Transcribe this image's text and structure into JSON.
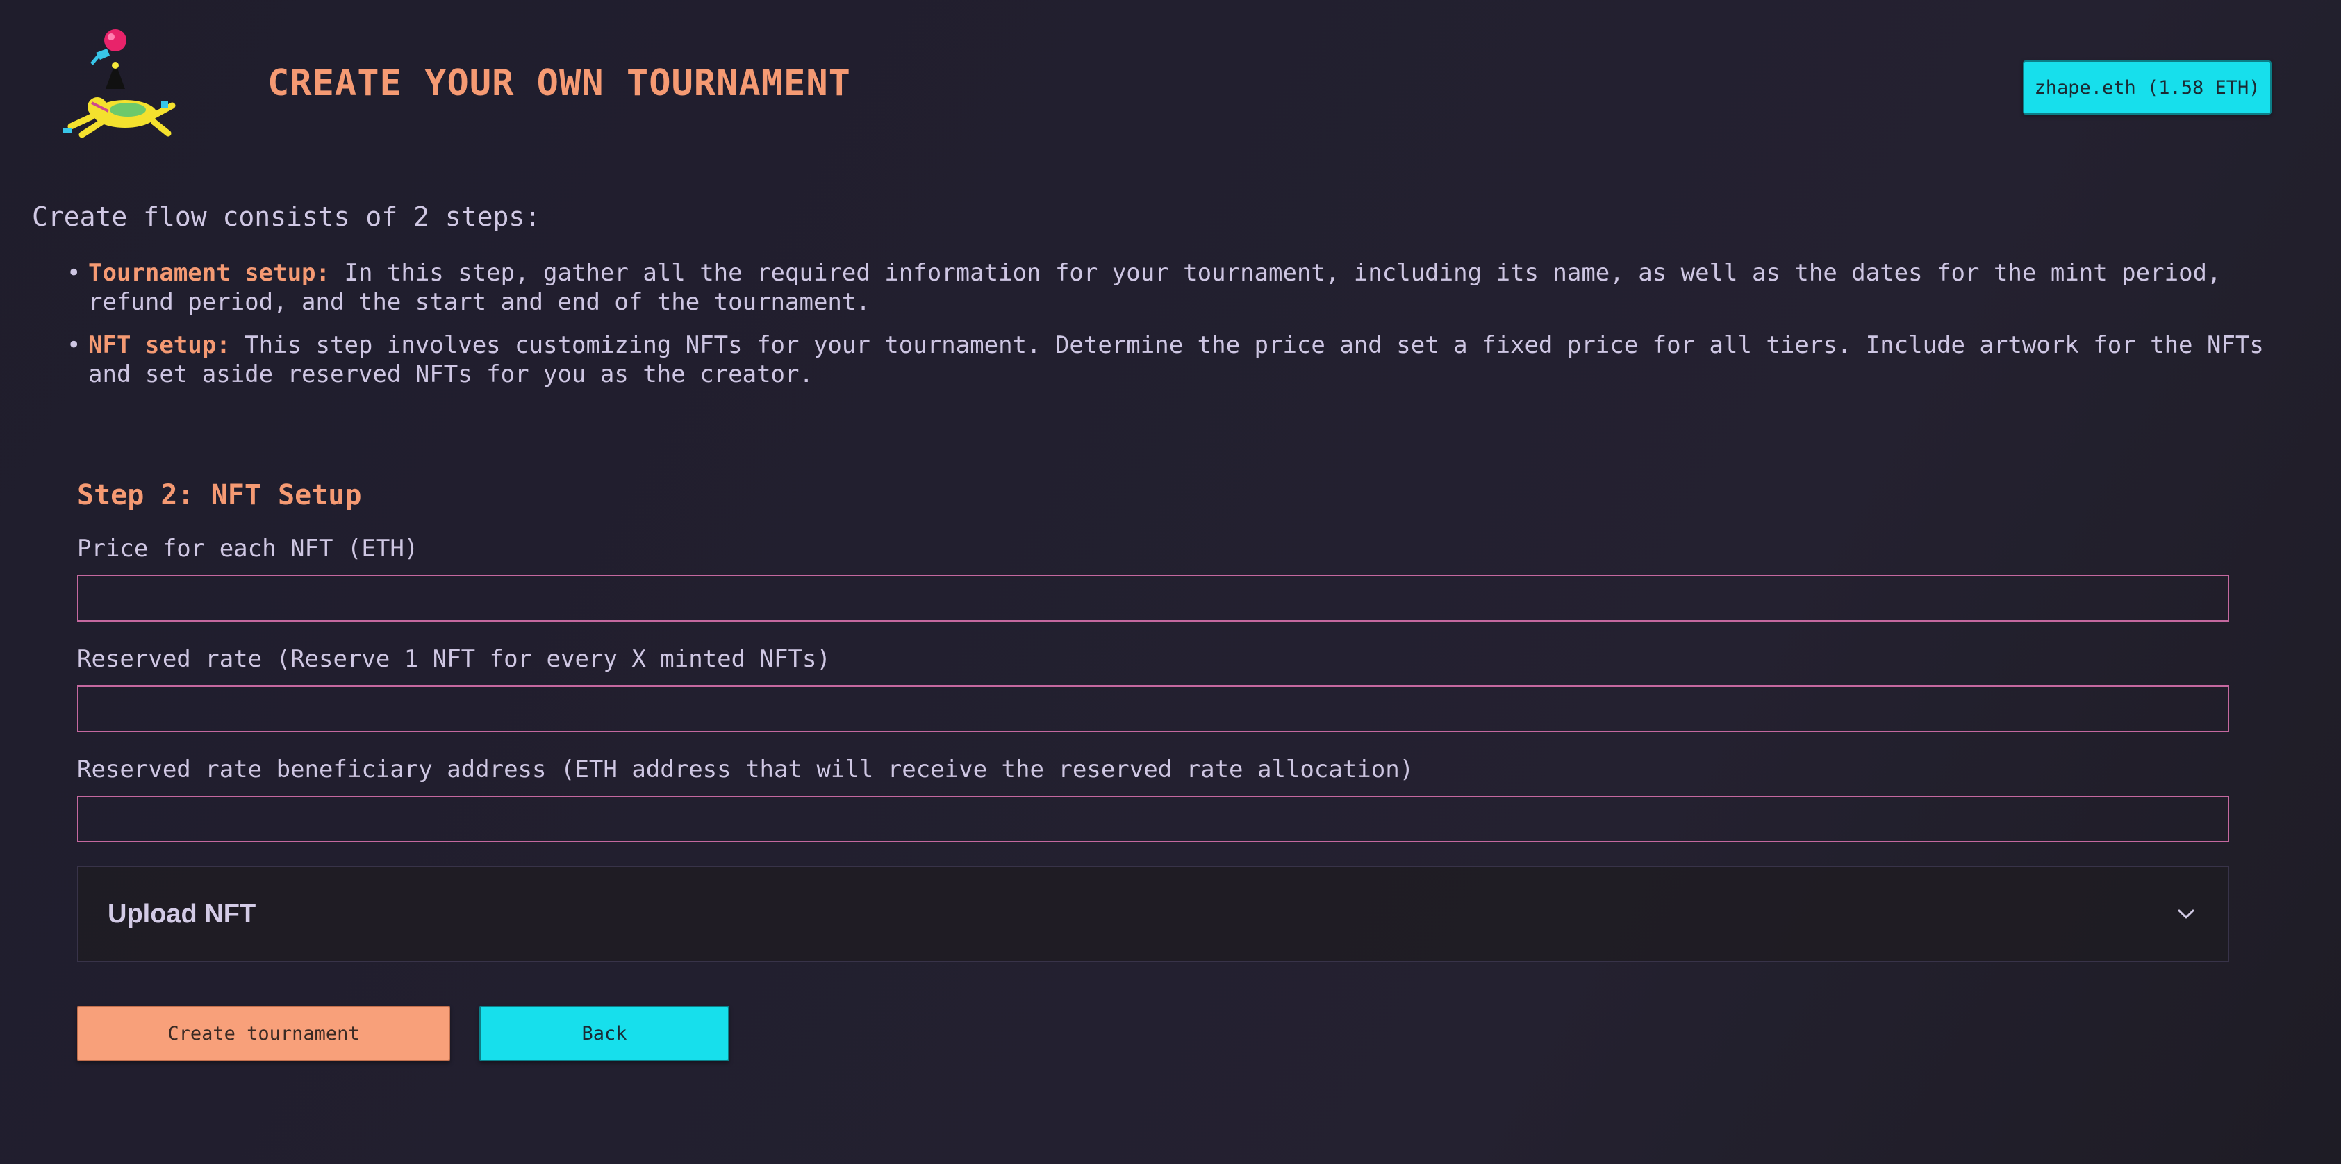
{
  "header": {
    "title": "CREATE YOUR OWN TOURNAMENT",
    "wallet_label": "zhape.eth (1.58 ETH)"
  },
  "intro": {
    "text": "Create flow consists of 2 steps:",
    "steps": [
      {
        "term": "Tournament setup:",
        "description": " In this step, gather all the required information for your tournament, including its name, as well as the dates for the mint period, refund period, and the start and end of the tournament."
      },
      {
        "term": "NFT setup:",
        "description": " This step involves customizing NFTs for your tournament. Determine the price and set a fixed price for all tiers. Include artwork for the NFTs and set aside reserved NFTs for you as the creator."
      }
    ]
  },
  "form": {
    "step_title": "Step 2: NFT Setup",
    "fields": [
      {
        "label": "Price for each NFT (ETH)",
        "value": ""
      },
      {
        "label": "Reserved rate (Reserve 1 NFT for every X minted NFTs)",
        "value": ""
      },
      {
        "label": "Reserved rate beneficiary address (ETH address that will receive the reserved rate allocation)",
        "value": ""
      }
    ],
    "upload_label": "Upload NFT"
  },
  "actions": {
    "create_label": "Create tournament",
    "back_label": "Back"
  },
  "colors": {
    "accent_orange": "#f59a73",
    "accent_cyan": "#17dfec",
    "input_border": "#c4689f",
    "background": "#211f2e"
  },
  "icons": {
    "logo": "tournament-mascot-logo",
    "accordion": "chevron-down-icon"
  }
}
